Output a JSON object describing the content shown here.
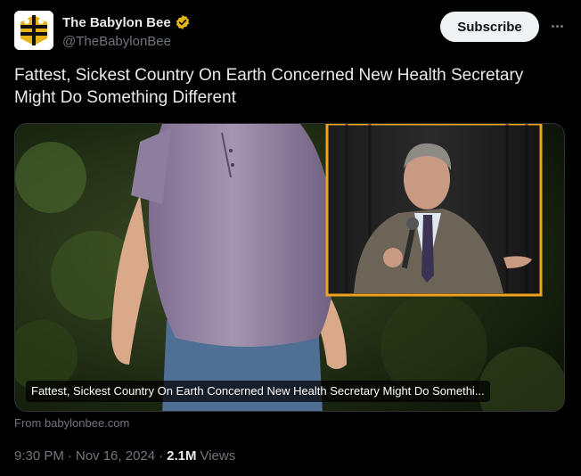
{
  "account": {
    "display_name": "The Babylon Bee",
    "handle": "@TheBabylonBee",
    "verified_color": "#e2b719",
    "avatar_icon": "bee-logo-icon"
  },
  "actions": {
    "subscribe_label": "Subscribe",
    "more_icon": "more-dots-icon"
  },
  "tweet": {
    "text": "Fattest, Sickest Country On Earth Concerned New Health Secretary Might Do Something Different"
  },
  "card": {
    "caption": "Fattest, Sickest Country On Earth Concerned New Health Secretary Might Do Somethi...",
    "source_prefix": "From ",
    "source_domain": "babylonbee.com",
    "inset_border_color": "#f0a21e"
  },
  "meta": {
    "time": "9:30 PM",
    "sep1": "·",
    "date": "Nov 16, 2024",
    "sep2": "·",
    "views_count": "2.1M",
    "views_label": "Views"
  }
}
